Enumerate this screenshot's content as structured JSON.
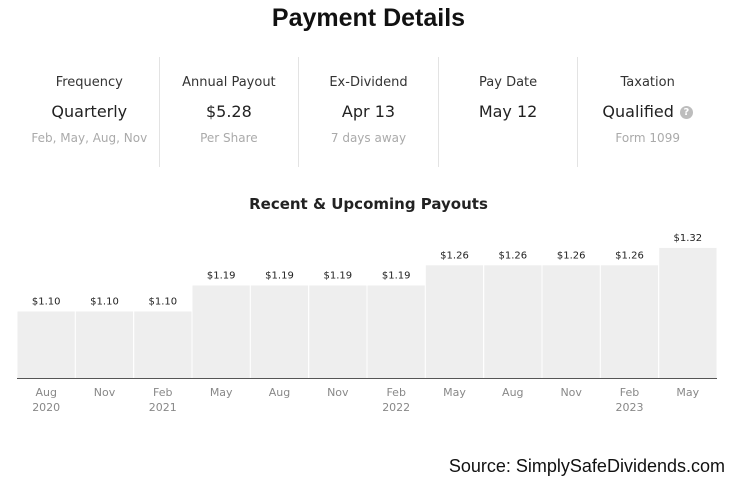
{
  "title": "Payment Details",
  "stats": [
    {
      "label": "Frequency",
      "value": "Quarterly",
      "sub": "Feb, May, Aug, Nov"
    },
    {
      "label": "Annual Payout",
      "value": "$5.28",
      "sub": "Per Share"
    },
    {
      "label": "Ex-Dividend",
      "value": "Apr 13",
      "sub": "7 days away"
    },
    {
      "label": "Pay Date",
      "value": "May 12",
      "sub": ""
    },
    {
      "label": "Taxation",
      "value": "Qualified",
      "sub": "Form 1099",
      "icon": "help-icon"
    }
  ],
  "chart_data": {
    "type": "bar",
    "title": "Recent & Upcoming Payouts",
    "categories": [
      "Aug 2020",
      "Nov",
      "Feb 2021",
      "May",
      "Aug",
      "Nov",
      "Feb 2022",
      "May",
      "Aug",
      "Nov",
      "Feb 2023",
      "May"
    ],
    "category_labels": [
      [
        "Aug",
        "2020"
      ],
      [
        "Nov"
      ],
      [
        "Feb",
        "2021"
      ],
      [
        "May"
      ],
      [
        "Aug"
      ],
      [
        "Nov"
      ],
      [
        "Feb",
        "2022"
      ],
      [
        "May"
      ],
      [
        "Aug"
      ],
      [
        "Nov"
      ],
      [
        "Feb",
        "2023"
      ],
      [
        "May"
      ]
    ],
    "values": [
      1.1,
      1.1,
      1.1,
      1.19,
      1.19,
      1.19,
      1.19,
      1.26,
      1.26,
      1.26,
      1.26,
      1.32
    ],
    "value_labels": [
      "$1.10",
      "$1.10",
      "$1.10",
      "$1.19",
      "$1.19",
      "$1.19",
      "$1.19",
      "$1.26",
      "$1.26",
      "$1.26",
      "$1.26",
      "$1.32"
    ],
    "ylim": [
      0.87,
      1.35
    ],
    "xlabel": "",
    "ylabel": "",
    "colors": {
      "bar": "#eeeeee",
      "baseline": "#555555",
      "tick_label": "#888888",
      "value_label": "#222222"
    }
  },
  "source": "Source: SimplySafeDividends.com"
}
